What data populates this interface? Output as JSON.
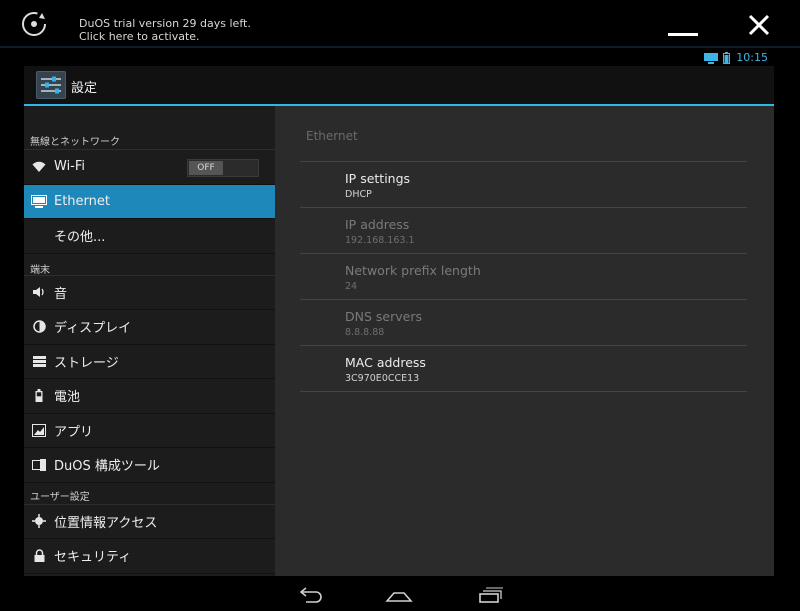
{
  "duos": {
    "trial_line1": "DuOS trial version 29 days left.",
    "trial_line2": "Click here to activate.",
    "logo_icon": "duos-logo-icon",
    "minimize_icon": "minimize-icon",
    "close_icon": "close-icon"
  },
  "status_bar": {
    "time": "10:15",
    "icons": [
      "screen-icon",
      "battery-icon"
    ]
  },
  "action_bar": {
    "title": "設定",
    "icon": "settings-icon"
  },
  "sidebar": {
    "sections": [
      {
        "header": "無線とネットワーク",
        "items": [
          {
            "label": "Wi-Fi",
            "icon": "wifi-icon",
            "toggle": "OFF"
          },
          {
            "label": "Ethernet",
            "icon": "monitor-icon",
            "active": true
          },
          {
            "label": "その他...",
            "icon": ""
          }
        ]
      },
      {
        "header": "端末",
        "items": [
          {
            "label": "音",
            "icon": "speaker-icon"
          },
          {
            "label": "ディスプレイ",
            "icon": "brightness-icon"
          },
          {
            "label": "ストレージ",
            "icon": "storage-icon"
          },
          {
            "label": "電池",
            "icon": "battery-icon"
          },
          {
            "label": "アプリ",
            "icon": "apps-icon"
          },
          {
            "label": "DuOS 構成ツール",
            "icon": "duos-config-icon"
          }
        ]
      },
      {
        "header": "ユーザー設定",
        "items": [
          {
            "label": "位置情報アクセス",
            "icon": "location-icon"
          },
          {
            "label": "セキュリティ",
            "icon": "lock-icon"
          }
        ]
      }
    ]
  },
  "main": {
    "title": "Ethernet",
    "prefs": [
      {
        "title": "IP settings",
        "summary": "DHCP",
        "enabled": true
      },
      {
        "title": "IP address",
        "summary": "192.168.163.1",
        "enabled": false
      },
      {
        "title": "Network prefix length",
        "summary": "24",
        "enabled": false
      },
      {
        "title": "DNS servers",
        "summary": "8.8.8.88",
        "enabled": false
      },
      {
        "title": "MAC address",
        "summary": "3C970E0CCE13",
        "enabled": true
      }
    ]
  },
  "nav_bar": {
    "buttons": [
      "back-icon",
      "home-icon",
      "recent-apps-icon"
    ]
  },
  "colors": {
    "accent": "#33b5e5",
    "active_item": "#1e88ba",
    "panel_bg": "#2b2b2b",
    "sidebar_bg": "#1c1c1c"
  }
}
